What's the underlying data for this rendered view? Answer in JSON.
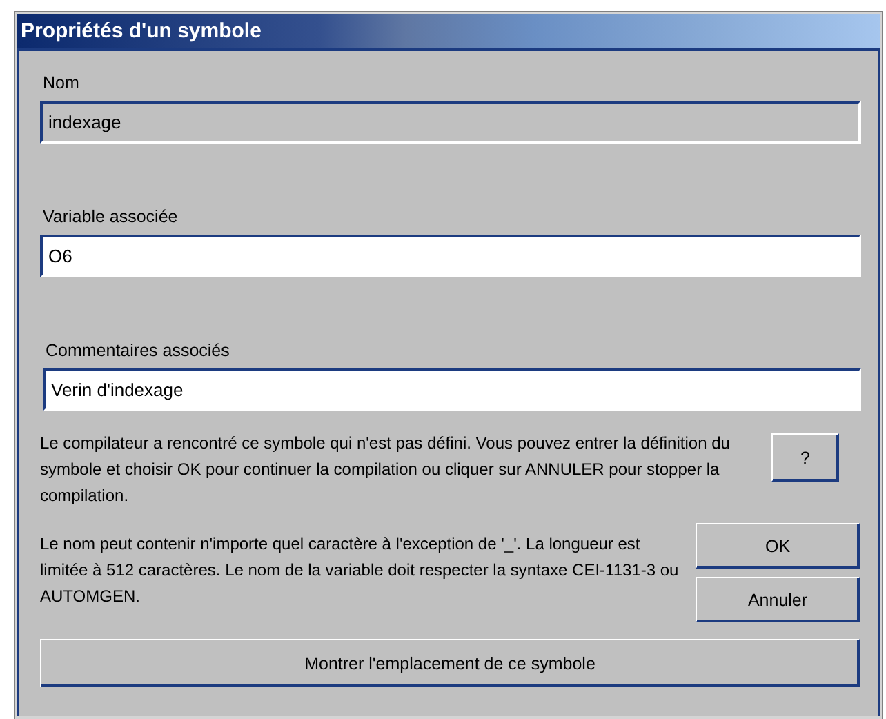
{
  "window": {
    "title": "Propriétés d'un symbole"
  },
  "fields": [
    {
      "label": "Nom",
      "value": "indexage",
      "readonly": true
    },
    {
      "label": "Variable associée",
      "value": "O6",
      "readonly": false
    },
    {
      "label": "Commentaires associés",
      "value": "Verin d'indexage",
      "readonly": false
    }
  ],
  "help_text": "Le compilateur a rencontré ce symbole qui n'est pas défini. Vous pouvez entrer la définition du symbole et choisir OK pour continuer la compilation ou cliquer sur ANNULER pour stopper la compilation.",
  "help_button": {
    "label": "?"
  },
  "note_text": "Le nom peut contenir n'importe quel caractère à l'exception de '_'. La longueur est limitée à 512 caractères. Le nom de la variable doit respecter la syntaxe CEI-1131-3 ou AUTOMGEN.",
  "buttons": [
    {
      "label": "OK"
    },
    {
      "label": "Annuler"
    }
  ],
  "show_location_button": {
    "label": "Montrer l'emplacement de ce symbole"
  }
}
